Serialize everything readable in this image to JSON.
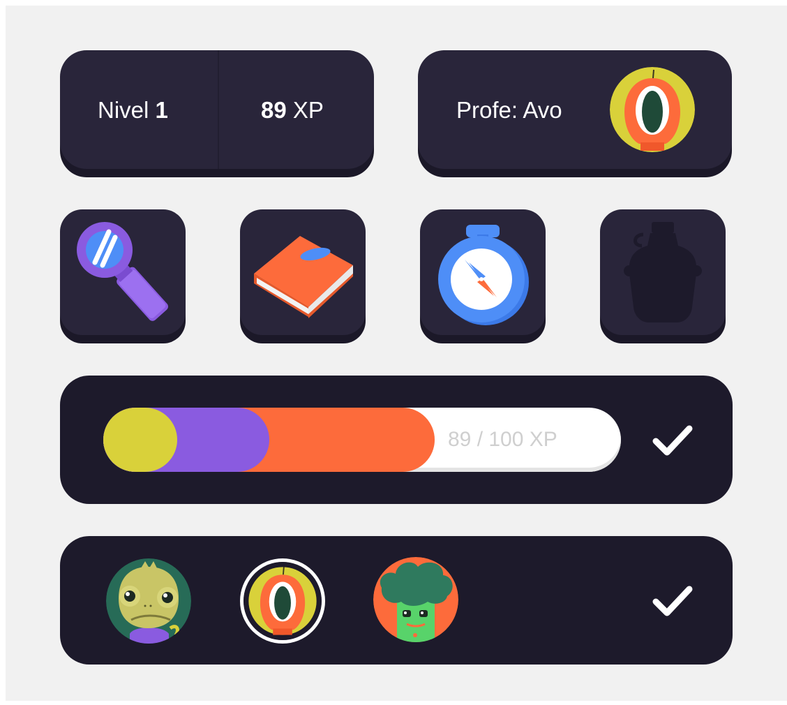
{
  "stats": {
    "level_label": "Nivel",
    "level_value": "1",
    "xp_value": "89",
    "xp_unit": "XP"
  },
  "teacher": {
    "label": "Profe: Avo",
    "avatar_icon": "cyclops-avatar-icon"
  },
  "tools": [
    {
      "name": "magnifying-glass-icon",
      "unlocked": true
    },
    {
      "name": "book-icon",
      "unlocked": true
    },
    {
      "name": "compass-icon",
      "unlocked": true
    },
    {
      "name": "canteen-icon",
      "unlocked": false
    }
  ],
  "progress": {
    "label": "89 / 100 XP",
    "value": 89,
    "max": 100,
    "colors": [
      "#d9d13a",
      "#8a5be0",
      "#fd6b3b"
    ]
  },
  "avatars": [
    {
      "name": "chameleon-avatar-icon",
      "selected": false
    },
    {
      "name": "cyclops-avatar-icon",
      "selected": true
    },
    {
      "name": "tree-monster-avatar-icon",
      "selected": false
    }
  ],
  "colors": {
    "card": "#29253a",
    "panel": "#1d1a2b",
    "yellow": "#d9d13a",
    "purple": "#8a5be0",
    "orange": "#fd6b3b",
    "blue": "#4e8ef7"
  }
}
